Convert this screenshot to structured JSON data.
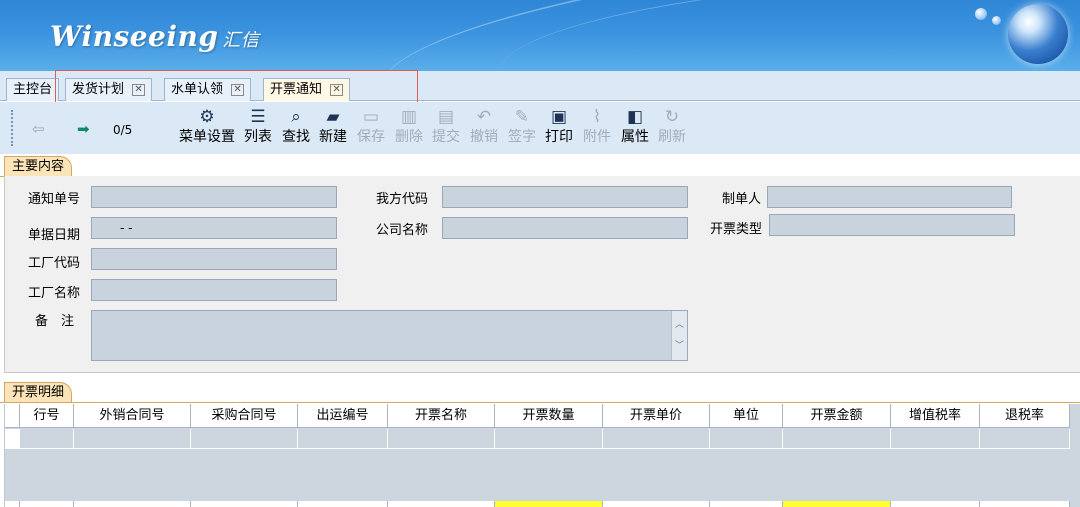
{
  "brand": {
    "logo_text": "Winseeing",
    "logo_cn": "汇信"
  },
  "tabs": [
    {
      "label": "主控台",
      "closable": false,
      "active": false
    },
    {
      "label": "发货计划",
      "closable": true,
      "active": false
    },
    {
      "label": "水单认领",
      "closable": true,
      "active": false
    },
    {
      "label": "开票通知",
      "closable": true,
      "active": true
    }
  ],
  "nav": {
    "prev_icon": "arrow-left-icon",
    "next_icon": "arrow-right-icon",
    "counter": "0/5"
  },
  "toolbar": [
    {
      "label": "菜单设置",
      "icon": "gear-icon",
      "enabled": true
    },
    {
      "label": "列表",
      "icon": "list-icon",
      "enabled": true
    },
    {
      "label": "查找",
      "icon": "search-icon",
      "enabled": true
    },
    {
      "label": "新建",
      "icon": "new-folder-icon",
      "enabled": true
    },
    {
      "label": "保存",
      "icon": "save-icon",
      "enabled": false
    },
    {
      "label": "删除",
      "icon": "trash-icon",
      "enabled": false
    },
    {
      "label": "提交",
      "icon": "clipboard-check-icon",
      "enabled": false
    },
    {
      "label": "撤销",
      "icon": "undo-icon",
      "enabled": false
    },
    {
      "label": "签字",
      "icon": "pen-icon",
      "enabled": false
    },
    {
      "label": "打印",
      "icon": "printer-icon",
      "enabled": true
    },
    {
      "label": "附件",
      "icon": "paperclip-icon",
      "enabled": false
    },
    {
      "label": "属性",
      "icon": "properties-icon",
      "enabled": true
    },
    {
      "label": "刷新",
      "icon": "refresh-icon",
      "enabled": false
    }
  ],
  "main_section": {
    "title": "主要内容",
    "fields": {
      "notice_no": {
        "label": "通知单号",
        "value": ""
      },
      "doc_date": {
        "label": "单据日期",
        "value": "- -"
      },
      "factory_code": {
        "label": "工厂代码",
        "value": ""
      },
      "factory_name": {
        "label": "工厂名称",
        "value": ""
      },
      "remark": {
        "label": "备　注",
        "value": ""
      },
      "our_code": {
        "label": "我方代码",
        "value": ""
      },
      "company_name": {
        "label": "公司名称",
        "value": ""
      },
      "creator": {
        "label": "制单人",
        "value": ""
      },
      "invoice_type": {
        "label": "开票类型",
        "value": ""
      }
    }
  },
  "detail_section": {
    "title": "开票明细",
    "columns": [
      "行号",
      "外销合同号",
      "采购合同号",
      "出运编号",
      "开票名称",
      "开票数量",
      "开票单价",
      "单位",
      "开票金额",
      "增值税率",
      "退税率"
    ],
    "rows": [
      [
        "",
        "",
        "",
        "",
        "",
        "",
        "",
        "",
        "",
        "",
        ""
      ]
    ]
  }
}
